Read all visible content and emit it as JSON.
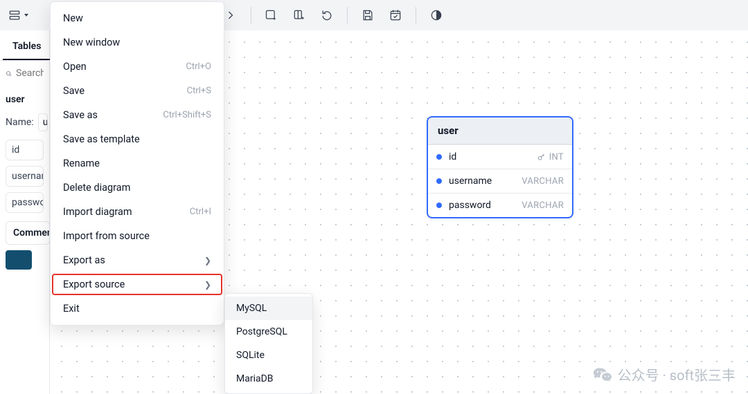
{
  "toolbar": {
    "layout_btn": "layout",
    "new_panel": "add-panel",
    "rotate": "rotate",
    "save": "save",
    "checklist": "checklist",
    "theme": "theme"
  },
  "sidebar": {
    "tab": "Tables",
    "search_placeholder": "Search...",
    "table_label": "user",
    "name_label": "Name:",
    "name_value": "user",
    "fields": [
      "id",
      "username",
      "password"
    ],
    "comments_btn": "Comments"
  },
  "menu": {
    "items": [
      {
        "label": "New",
        "shortcut": ""
      },
      {
        "label": "New window",
        "shortcut": ""
      },
      {
        "label": "Open",
        "shortcut": "Ctrl+O"
      },
      {
        "label": "Save",
        "shortcut": "Ctrl+S"
      },
      {
        "label": "Save as",
        "shortcut": "Ctrl+Shift+S"
      },
      {
        "label": "Save as template",
        "shortcut": ""
      },
      {
        "label": "Rename",
        "shortcut": ""
      },
      {
        "label": "Delete diagram",
        "shortcut": ""
      },
      {
        "label": "Import diagram",
        "shortcut": "Ctrl+I"
      },
      {
        "label": "Import from source",
        "shortcut": ""
      },
      {
        "label": "Export as",
        "shortcut": "",
        "arrow": true
      },
      {
        "label": "Export source",
        "shortcut": "",
        "arrow": true,
        "highlight": true
      },
      {
        "label": "Exit",
        "shortcut": ""
      }
    ]
  },
  "submenu": {
    "items": [
      "MySQL",
      "PostgreSQL",
      "SQLite",
      "MariaDB"
    ]
  },
  "table": {
    "name": "user",
    "columns": [
      {
        "name": "id",
        "type": "INT",
        "key": true
      },
      {
        "name": "username",
        "type": "VARCHAR",
        "key": false
      },
      {
        "name": "password",
        "type": "VARCHAR",
        "key": false
      }
    ]
  },
  "watermark": {
    "text": "公众号 · soft张三丰"
  }
}
